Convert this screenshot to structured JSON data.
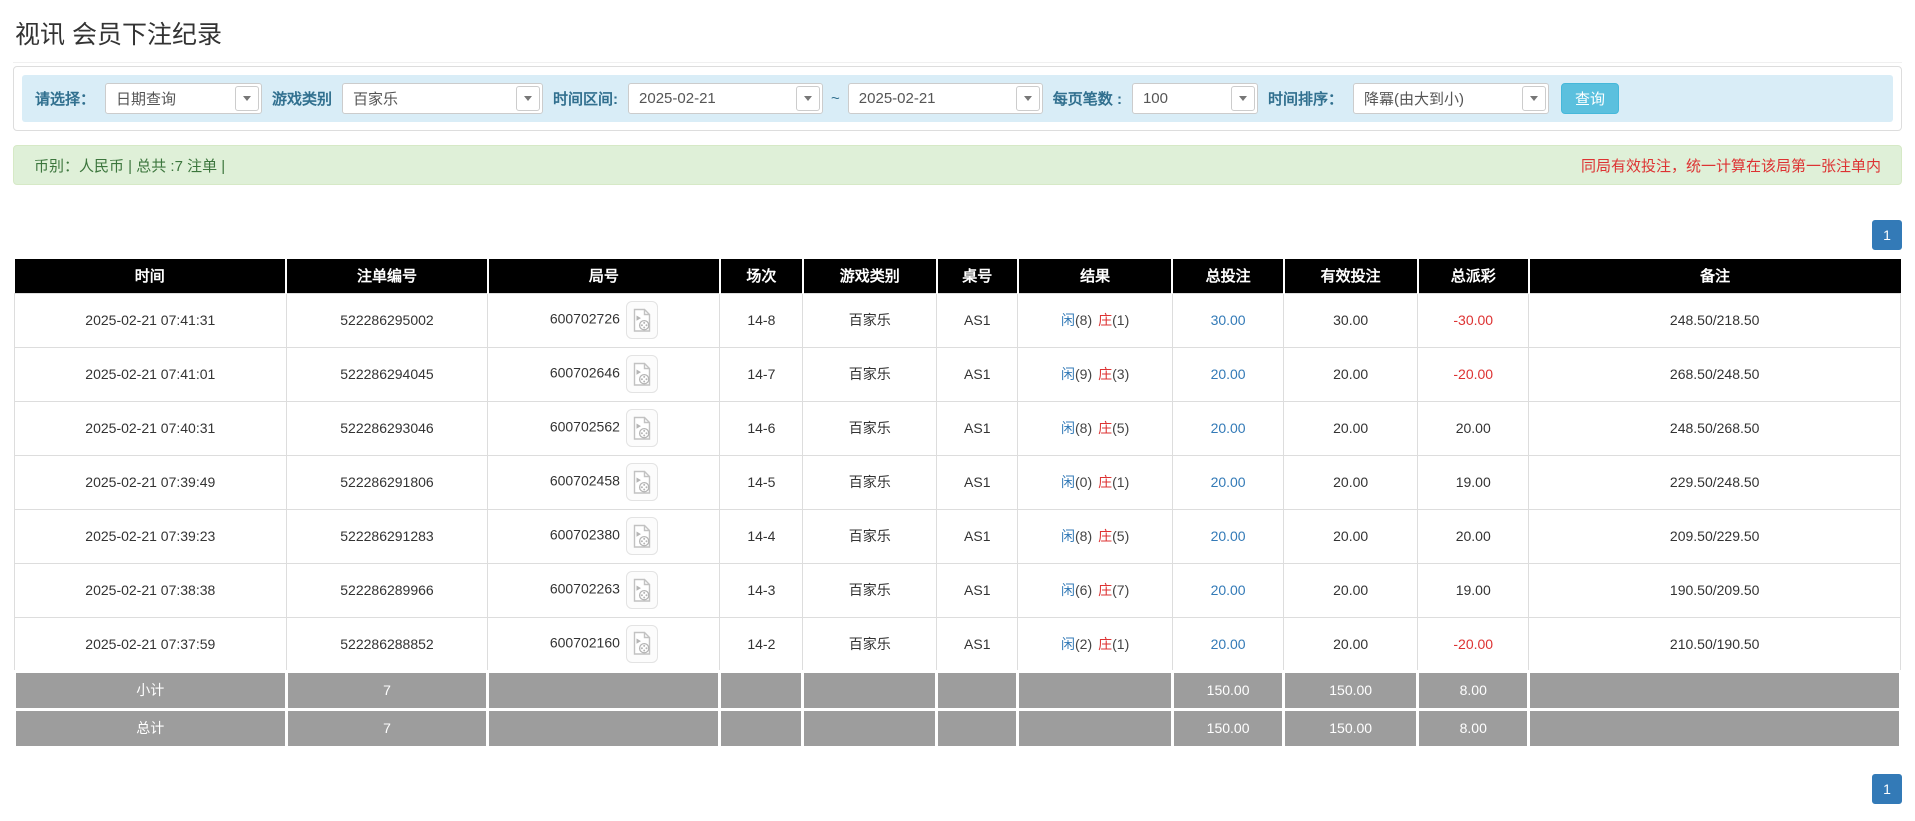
{
  "page": {
    "title": "视讯 会员下注纪录"
  },
  "filters": {
    "select_label": "请选择：",
    "select_value": "日期查询",
    "game_label": "游戏类别",
    "game_value": "百家乐",
    "range_label": "时间区间:",
    "date_from": "2025-02-21",
    "tilde": "~",
    "date_to": "2025-02-21",
    "page_size_label": "每页笔数 :",
    "page_size_value": "100",
    "sort_label": "时间排序：",
    "sort_value": "降冪(由大到小)",
    "search_button": "查询"
  },
  "summary": {
    "left": "币别：人民币 | 总共 :7 注单 |",
    "right": "同局有效投注，统一计算在该局第一张注单内"
  },
  "pagination": {
    "page": "1"
  },
  "table": {
    "headers": [
      "时间",
      "注单编号",
      "局号",
      "场次",
      "游戏类别",
      "桌号",
      "结果",
      "总投注",
      "有效投注",
      "总派彩",
      "备注"
    ],
    "video_icon": "video-replay-icon",
    "rows": [
      {
        "time": "2025-02-21 07:41:31",
        "bet_id": "522286295002",
        "round": "600702726",
        "session": "14-8",
        "game": "百家乐",
        "table_no": "AS1",
        "result_p_label": "闲",
        "result_p_num": "(8)",
        "result_b_label": "庄",
        "result_b_num": "(1)",
        "total_bet": "30.00",
        "valid_bet": "30.00",
        "payout": "-30.00",
        "remark": "248.50/218.50"
      },
      {
        "time": "2025-02-21 07:41:01",
        "bet_id": "522286294045",
        "round": "600702646",
        "session": "14-7",
        "game": "百家乐",
        "table_no": "AS1",
        "result_p_label": "闲",
        "result_p_num": "(9)",
        "result_b_label": "庄",
        "result_b_num": "(3)",
        "total_bet": "20.00",
        "valid_bet": "20.00",
        "payout": "-20.00",
        "remark": "268.50/248.50"
      },
      {
        "time": "2025-02-21 07:40:31",
        "bet_id": "522286293046",
        "round": "600702562",
        "session": "14-6",
        "game": "百家乐",
        "table_no": "AS1",
        "result_p_label": "闲",
        "result_p_num": "(8)",
        "result_b_label": "庄",
        "result_b_num": "(5)",
        "total_bet": "20.00",
        "valid_bet": "20.00",
        "payout": "20.00",
        "remark": "248.50/268.50"
      },
      {
        "time": "2025-02-21 07:39:49",
        "bet_id": "522286291806",
        "round": "600702458",
        "session": "14-5",
        "game": "百家乐",
        "table_no": "AS1",
        "result_p_label": "闲",
        "result_p_num": "(0)",
        "result_b_label": "庄",
        "result_b_num": "(1)",
        "total_bet": "20.00",
        "valid_bet": "20.00",
        "payout": "19.00",
        "remark": "229.50/248.50"
      },
      {
        "time": "2025-02-21 07:39:23",
        "bet_id": "522286291283",
        "round": "600702380",
        "session": "14-4",
        "game": "百家乐",
        "table_no": "AS1",
        "result_p_label": "闲",
        "result_p_num": "(8)",
        "result_b_label": "庄",
        "result_b_num": "(5)",
        "total_bet": "20.00",
        "valid_bet": "20.00",
        "payout": "20.00",
        "remark": "209.50/229.50"
      },
      {
        "time": "2025-02-21 07:38:38",
        "bet_id": "522286289966",
        "round": "600702263",
        "session": "14-3",
        "game": "百家乐",
        "table_no": "AS1",
        "result_p_label": "闲",
        "result_p_num": "(6)",
        "result_b_label": "庄",
        "result_b_num": "(7)",
        "total_bet": "20.00",
        "valid_bet": "20.00",
        "payout": "19.00",
        "remark": "190.50/209.50"
      },
      {
        "time": "2025-02-21 07:37:59",
        "bet_id": "522286288852",
        "round": "600702160",
        "session": "14-2",
        "game": "百家乐",
        "table_no": "AS1",
        "result_p_label": "闲",
        "result_p_num": "(2)",
        "result_b_label": "庄",
        "result_b_num": "(1)",
        "total_bet": "20.00",
        "valid_bet": "20.00",
        "payout": "-20.00",
        "remark": "210.50/190.50"
      }
    ],
    "subtotal": {
      "label": "小计",
      "count": "7",
      "total_bet": "150.00",
      "valid_bet": "150.00",
      "payout": "8.00"
    },
    "total": {
      "label": "总计",
      "count": "7",
      "total_bet": "150.00",
      "valid_bet": "150.00",
      "payout": "8.00"
    }
  },
  "colors": {
    "accent_blue": "#337ab7",
    "info_button": "#5bc0de",
    "filter_bar_bg": "#d9edf7",
    "filter_label": "#31708f",
    "alert_bg": "#dff0d8",
    "alert_text_green": "#3c763d",
    "warning_red": "#dd3333",
    "table_header_bg": "#000000",
    "table_footer_bg": "#9d9d9d"
  }
}
